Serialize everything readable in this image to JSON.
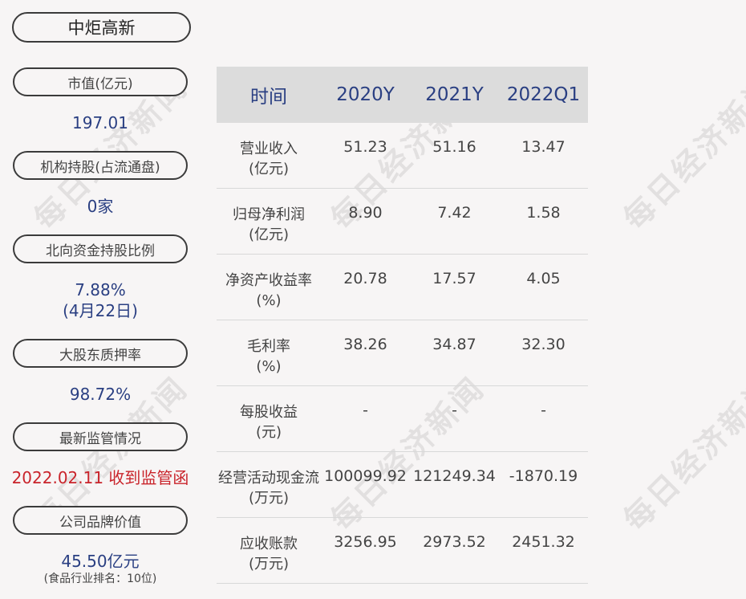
{
  "company": "中炬高新",
  "watermark": "每日经济新闻",
  "left_panel": [
    {
      "label": "市值(亿元)",
      "value": "197.01"
    },
    {
      "label": "机构持股(占流通盘)",
      "value": "0家"
    },
    {
      "label": "北向资金持股比例",
      "value": "7.88%",
      "value2": "(4月22日)"
    },
    {
      "label": "大股东质押率",
      "value": "98.72%"
    },
    {
      "label": "最新监管情况",
      "value": "2022.02.11 收到监管函"
    },
    {
      "label": "公司品牌价值",
      "value": "45.50亿元",
      "value2": "(食品行业排名：10位)"
    }
  ],
  "table": {
    "headers": [
      "时间",
      "2020Y",
      "2021Y",
      "2022Q1"
    ],
    "rows": [
      {
        "label": "营业收入",
        "unit": "(亿元)",
        "values": [
          "51.23",
          "51.16",
          "13.47"
        ]
      },
      {
        "label": "归母净利润",
        "unit": "(亿元)",
        "values": [
          "8.90",
          "7.42",
          "1.58"
        ]
      },
      {
        "label": "净资产收益率",
        "unit": "(%)",
        "values": [
          "20.78",
          "17.57",
          "4.05"
        ]
      },
      {
        "label": "毛利率",
        "unit": "(%)",
        "values": [
          "38.26",
          "34.87",
          "32.30"
        ]
      },
      {
        "label": "每股收益",
        "unit": "(元)",
        "values": [
          "-",
          "-",
          "-"
        ]
      },
      {
        "label": "经营活动现金流",
        "unit": "(万元)",
        "values": [
          "100099.92",
          "121249.34",
          "-1870.19"
        ]
      },
      {
        "label": "应收账款",
        "unit": "(万元)",
        "values": [
          "3256.95",
          "2973.52",
          "2451.32"
        ]
      }
    ]
  }
}
